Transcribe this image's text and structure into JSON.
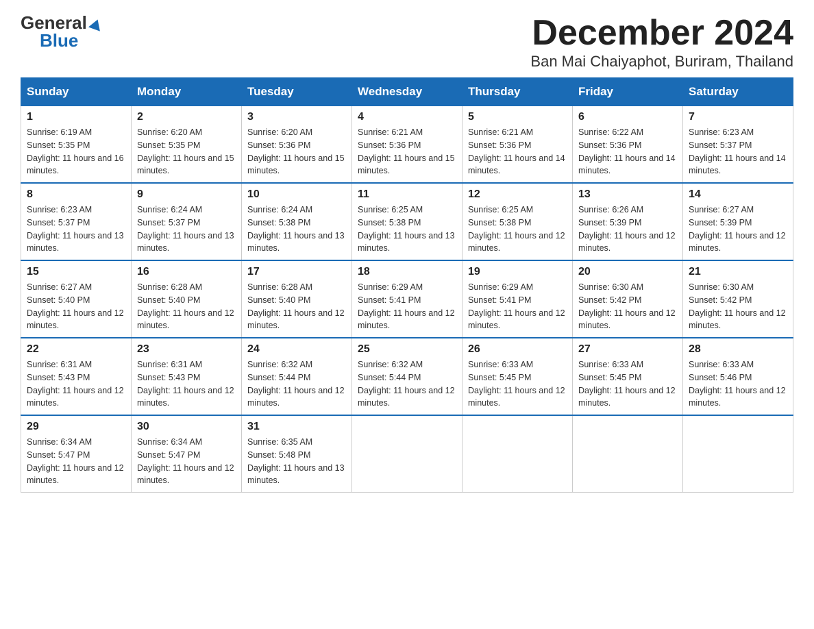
{
  "header": {
    "logo_general": "General",
    "logo_blue": "Blue",
    "title": "December 2024",
    "subtitle": "Ban Mai Chaiyaphot, Buriram, Thailand"
  },
  "days_of_week": [
    "Sunday",
    "Monday",
    "Tuesday",
    "Wednesday",
    "Thursday",
    "Friday",
    "Saturday"
  ],
  "weeks": [
    [
      {
        "day": "1",
        "sunrise": "6:19 AM",
        "sunset": "5:35 PM",
        "daylight": "11 hours and 16 minutes."
      },
      {
        "day": "2",
        "sunrise": "6:20 AM",
        "sunset": "5:35 PM",
        "daylight": "11 hours and 15 minutes."
      },
      {
        "day": "3",
        "sunrise": "6:20 AM",
        "sunset": "5:36 PM",
        "daylight": "11 hours and 15 minutes."
      },
      {
        "day": "4",
        "sunrise": "6:21 AM",
        "sunset": "5:36 PM",
        "daylight": "11 hours and 15 minutes."
      },
      {
        "day": "5",
        "sunrise": "6:21 AM",
        "sunset": "5:36 PM",
        "daylight": "11 hours and 14 minutes."
      },
      {
        "day": "6",
        "sunrise": "6:22 AM",
        "sunset": "5:36 PM",
        "daylight": "11 hours and 14 minutes."
      },
      {
        "day": "7",
        "sunrise": "6:23 AM",
        "sunset": "5:37 PM",
        "daylight": "11 hours and 14 minutes."
      }
    ],
    [
      {
        "day": "8",
        "sunrise": "6:23 AM",
        "sunset": "5:37 PM",
        "daylight": "11 hours and 13 minutes."
      },
      {
        "day": "9",
        "sunrise": "6:24 AM",
        "sunset": "5:37 PM",
        "daylight": "11 hours and 13 minutes."
      },
      {
        "day": "10",
        "sunrise": "6:24 AM",
        "sunset": "5:38 PM",
        "daylight": "11 hours and 13 minutes."
      },
      {
        "day": "11",
        "sunrise": "6:25 AM",
        "sunset": "5:38 PM",
        "daylight": "11 hours and 13 minutes."
      },
      {
        "day": "12",
        "sunrise": "6:25 AM",
        "sunset": "5:38 PM",
        "daylight": "11 hours and 12 minutes."
      },
      {
        "day": "13",
        "sunrise": "6:26 AM",
        "sunset": "5:39 PM",
        "daylight": "11 hours and 12 minutes."
      },
      {
        "day": "14",
        "sunrise": "6:27 AM",
        "sunset": "5:39 PM",
        "daylight": "11 hours and 12 minutes."
      }
    ],
    [
      {
        "day": "15",
        "sunrise": "6:27 AM",
        "sunset": "5:40 PM",
        "daylight": "11 hours and 12 minutes."
      },
      {
        "day": "16",
        "sunrise": "6:28 AM",
        "sunset": "5:40 PM",
        "daylight": "11 hours and 12 minutes."
      },
      {
        "day": "17",
        "sunrise": "6:28 AM",
        "sunset": "5:40 PM",
        "daylight": "11 hours and 12 minutes."
      },
      {
        "day": "18",
        "sunrise": "6:29 AM",
        "sunset": "5:41 PM",
        "daylight": "11 hours and 12 minutes."
      },
      {
        "day": "19",
        "sunrise": "6:29 AM",
        "sunset": "5:41 PM",
        "daylight": "11 hours and 12 minutes."
      },
      {
        "day": "20",
        "sunrise": "6:30 AM",
        "sunset": "5:42 PM",
        "daylight": "11 hours and 12 minutes."
      },
      {
        "day": "21",
        "sunrise": "6:30 AM",
        "sunset": "5:42 PM",
        "daylight": "11 hours and 12 minutes."
      }
    ],
    [
      {
        "day": "22",
        "sunrise": "6:31 AM",
        "sunset": "5:43 PM",
        "daylight": "11 hours and 12 minutes."
      },
      {
        "day": "23",
        "sunrise": "6:31 AM",
        "sunset": "5:43 PM",
        "daylight": "11 hours and 12 minutes."
      },
      {
        "day": "24",
        "sunrise": "6:32 AM",
        "sunset": "5:44 PM",
        "daylight": "11 hours and 12 minutes."
      },
      {
        "day": "25",
        "sunrise": "6:32 AM",
        "sunset": "5:44 PM",
        "daylight": "11 hours and 12 minutes."
      },
      {
        "day": "26",
        "sunrise": "6:33 AM",
        "sunset": "5:45 PM",
        "daylight": "11 hours and 12 minutes."
      },
      {
        "day": "27",
        "sunrise": "6:33 AM",
        "sunset": "5:45 PM",
        "daylight": "11 hours and 12 minutes."
      },
      {
        "day": "28",
        "sunrise": "6:33 AM",
        "sunset": "5:46 PM",
        "daylight": "11 hours and 12 minutes."
      }
    ],
    [
      {
        "day": "29",
        "sunrise": "6:34 AM",
        "sunset": "5:47 PM",
        "daylight": "11 hours and 12 minutes."
      },
      {
        "day": "30",
        "sunrise": "6:34 AM",
        "sunset": "5:47 PM",
        "daylight": "11 hours and 12 minutes."
      },
      {
        "day": "31",
        "sunrise": "6:35 AM",
        "sunset": "5:48 PM",
        "daylight": "11 hours and 13 minutes."
      },
      null,
      null,
      null,
      null
    ]
  ]
}
